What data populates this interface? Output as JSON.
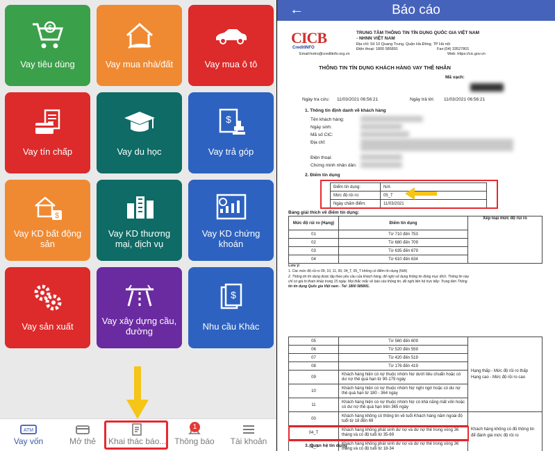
{
  "left_screen": {
    "tiles": [
      {
        "label": "Vay tiêu dùng",
        "icon": "shopping-cart-icon",
        "color": "#3aa04a"
      },
      {
        "label": "Vay mua nhà/đất",
        "icon": "house-icon",
        "color": "#f08a32"
      },
      {
        "label": "Vay mua ô tô",
        "icon": "car-icon",
        "color": "#dd2a2a"
      },
      {
        "label": "Vay tín chấp",
        "icon": "bill-card-icon",
        "color": "#dd2a2a"
      },
      {
        "label": "Vay du học",
        "icon": "graduation-cap-icon",
        "color": "#0e6b66"
      },
      {
        "label": "Vay trả góp",
        "icon": "document-stamp-icon",
        "color": "#2d62c0"
      },
      {
        "label": "Vay KD bất động sản",
        "icon": "real-estate-icon",
        "color": "#f08a32"
      },
      {
        "label": "Vay KD thương mại, dịch vụ",
        "icon": "buildings-icon",
        "color": "#0e6b66"
      },
      {
        "label": "Vay KD chứng khoán",
        "icon": "stock-chart-icon",
        "color": "#2d62c0"
      },
      {
        "label": "Vay sản xuất",
        "icon": "gears-icon",
        "color": "#dd2a2a"
      },
      {
        "label": "Vay xây dựng cầu, đường",
        "icon": "road-icon",
        "color": "#6a2aa0"
      },
      {
        "label": "Nhu cầu Khác",
        "icon": "documents-icon",
        "color": "#2d62c0"
      }
    ],
    "bottom_nav": [
      {
        "label": "Vay vốn",
        "icon": "atm-icon"
      },
      {
        "label": "Mở thẻ",
        "icon": "card-icon"
      },
      {
        "label": "Khai thác báo...",
        "icon": "report-icon"
      },
      {
        "label": "Thông báo",
        "icon": "bell-icon",
        "badge": "1"
      },
      {
        "label": "Tài khoản",
        "icon": "menu-icon"
      }
    ],
    "highlight_color": "#e8282f",
    "arrow_color": "#f5c518"
  },
  "right_screen": {
    "header_title": "Báo cáo",
    "header_color": "#4663bc",
    "logo": {
      "main": "CICB",
      "sub": "CreditINFO"
    },
    "org": {
      "name1": "TRUNG TÂM THÔNG TIN TÍN DỤNG QUỐC GIA VIỆT NAM",
      "name2": "- NHNN VIỆT NAM",
      "address": "Địa chỉ: Số 10 Quang Trung, Quận Hà Đông, TP Hà nội",
      "phone": "Điện thoại: 1800 585891",
      "fax": "Fax:(04) 33527801",
      "email": "Email:hotro@creditinfo.org.vn",
      "web": "Web: https://cic.gov.vn"
    },
    "report_title": "THÔNG TIN TÍN DỤNG KHÁCH HÀNG VAY THỂ NHÂN",
    "ma_vach_label": "Mã vạch:",
    "ngay_tra_cuu_label": "Ngày tra cứu:",
    "ngay_tra_cuu": "11/03/2021 06:56:21",
    "ngay_tra_loi_label": "Ngày trả lời:",
    "ngay_tra_loi": "11/03/2021 06:56:21",
    "section1": "1. Thông tin định danh về khách hàng",
    "fields": [
      "Tên khách hàng:",
      "Ngày sinh:",
      "Mã số CIC:",
      "Địa chỉ:",
      "Điện thoại:",
      "Chứng minh nhân dân:"
    ],
    "section2": "2. Điểm tín dụng",
    "score_rows": [
      {
        "label": "Điểm tín dụng:",
        "value": "N/A"
      },
      {
        "label": "Mức độ rủi ro:",
        "value": "05_T"
      },
      {
        "label": "Ngày chấm điểm:",
        "value": "11/03/2021"
      }
    ],
    "table_title": "Bảng giải thích về điểm tín dụng:",
    "table_headers": [
      "Mức độ rủi ro (Hạng)",
      "Điểm tín dụng",
      "Xếp loại mức độ rủi ro"
    ],
    "table_rows_top": [
      {
        "rank": "01",
        "range": "Từ 710 đến 753"
      },
      {
        "rank": "02",
        "range": "Từ 680 đến 709"
      },
      {
        "rank": "03",
        "range": "Từ 635 đến 679"
      },
      {
        "rank": "04",
        "range": "Từ 610 đến 634"
      }
    ],
    "notes_title": "Lưu ý:",
    "note1": "1. Các mức độ rủi ro 09, 10, 11, 00, 04_T, 05_T không có điểm tín dụng (N/A)",
    "note2a": "2. Thông tin tín dụng được lập theo yêu cầu của khách hàng, để nghị sử dụng thông tin đúng mục đích. Thông tin này",
    "note2b": "chỉ có giá trị tham khảo trong 15 ngày. Mọi thắc mắc về báo cáo thông tin, đề nghị liên hệ trực tiếp: Trung tâm Thông",
    "note2c": "tin tín dụng Quốc gia Việt nam - Tel: 1800 585891.",
    "table_rows_bottom": [
      {
        "rank": "05",
        "range": "Từ 560 đến 609"
      },
      {
        "rank": "06",
        "range": "Từ 520 đến 559"
      },
      {
        "rank": "07",
        "range": "Từ 420 đến 519"
      },
      {
        "rank": "08",
        "range": "Từ 176 đến 419"
      },
      {
        "rank": "09",
        "range": "Khách hàng hiện có nợ thuộc nhóm Nợ dưới tiêu chuẩn hoặc có dư nợ thẻ quá hạn từ 90-179 ngày"
      },
      {
        "rank": "10",
        "range": "Khách hàng hiện có nợ thuộc nhóm Nợ nghi ngờ hoặc có dư nợ thẻ quá hạn từ 180 - 364 ngày"
      },
      {
        "rank": "11",
        "range": "Khách hàng hiện có nợ thuộc nhóm Nợ có khả năng mất vốn hoặc có dư nợ thẻ quá hạn trên 365 ngày"
      },
      {
        "rank": "00",
        "range": "Khách hàng không có thông tin về tuổi Khách hàng năm ngoài độ tuổi từ 18 đến 69"
      },
      {
        "rank": "04_T",
        "range": "Khách hàng không phát sinh dư nợ và dư nợ thẻ trong vòng 36 tháng và có độ tuổi từ 35-69"
      },
      {
        "rank": "05_T",
        "range": "Khách hàng không phát sinh dư nợ và dư nợ thẻ trong vòng 36 tháng và có độ tuổi từ 18-34"
      }
    ],
    "classification_1": "Hạng thấp - Mức độ rủi ro thấp Hạng cao - Mức độ rủi ro cao",
    "classification_2": "Khách hàng không có đủ thông tin để đánh giá mức độ rủi ro",
    "section3": "3. Quan hệ tín dụng",
    "highlight_color": "#e8282f",
    "arrow_color": "#f5c518"
  }
}
